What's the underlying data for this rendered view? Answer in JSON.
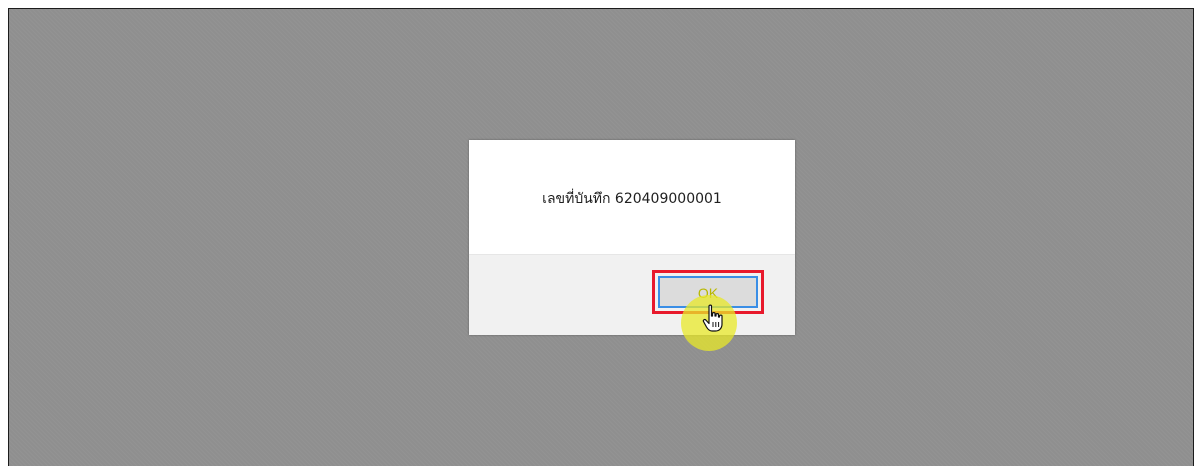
{
  "dialog": {
    "message": "เลขที่บันทึก 620409000001",
    "ok_label": "OK"
  },
  "icons": {
    "cursor": "hand-pointer-icon"
  },
  "colors": {
    "overlay": "#8f8f8f",
    "highlight": "#e8192c",
    "button_border": "#3a8ee6",
    "cursor_spot": "#e8e828"
  }
}
